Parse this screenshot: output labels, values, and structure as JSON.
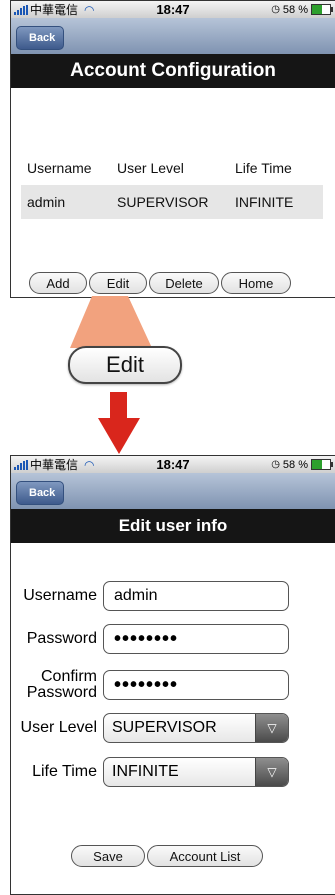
{
  "status": {
    "carrier": "中華電信",
    "time": "18:47",
    "battery": "58 %"
  },
  "nav": {
    "back_label": "Back"
  },
  "account": {
    "title": "Account Configuration",
    "headers": [
      "Username",
      "User Level",
      "Life Time"
    ],
    "rows": [
      {
        "username": "admin",
        "level": "SUPERVISOR",
        "lifetime": "INFINITE"
      }
    ],
    "buttons": {
      "add": "Add",
      "edit": "Edit",
      "delete": "Delete",
      "home": "Home"
    }
  },
  "callout": {
    "label": "Edit"
  },
  "edit": {
    "title": "Edit user info",
    "username_label": "Username",
    "username_value": "admin",
    "password_label": "Password",
    "password_value": "••••••••",
    "confirm_label_1": "Confirm",
    "confirm_label_2": "Password",
    "confirm_value": "••••••••",
    "level_label": "User Level",
    "level_value": "SUPERVISOR",
    "lifetime_label": "Life Time",
    "lifetime_value": "INFINITE",
    "save_label": "Save",
    "list_label": "Account List"
  },
  "colors": {
    "callout_fill": "#f2a27e",
    "arrow": "#d9261c",
    "navbar": "#8a9dbb",
    "titlebar": "#151515"
  },
  "icons": {
    "signal": "signal-bars-icon",
    "wifi": "wifi-icon",
    "battery": "battery-icon",
    "dropdown": "triangle-down-icon"
  }
}
